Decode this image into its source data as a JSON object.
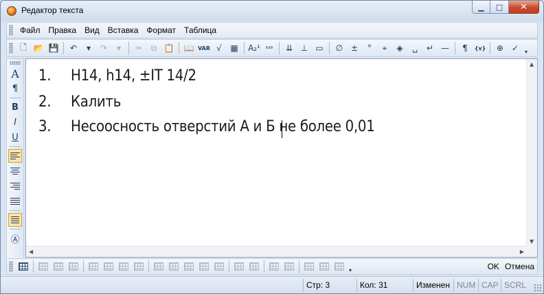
{
  "window": {
    "title": "Редактор текста",
    "controls": {
      "minimize": "▁",
      "maximize": "□",
      "close": "✕"
    }
  },
  "menu": [
    "Файл",
    "Правка",
    "Вид",
    "Вставка",
    "Формат",
    "Таблица"
  ],
  "toolbar": {
    "icons": [
      {
        "name": "new-file-icon",
        "glyph": "🗋"
      },
      {
        "name": "open-folder-icon",
        "glyph": "📂"
      },
      {
        "name": "save-icon",
        "glyph": "💾"
      },
      {
        "sep": true
      },
      {
        "name": "undo-icon",
        "glyph": "↶"
      },
      {
        "name": "undo-dropdown-icon",
        "glyph": "▾"
      },
      {
        "name": "redo-icon",
        "glyph": "↷",
        "disabled": true
      },
      {
        "name": "redo-dropdown-icon",
        "glyph": "▾",
        "disabled": true
      },
      {
        "sep": true
      },
      {
        "name": "cut-icon",
        "glyph": "✂",
        "disabled": true
      },
      {
        "name": "copy-icon",
        "glyph": "⧉",
        "disabled": true
      },
      {
        "name": "paste-icon",
        "glyph": "📋"
      },
      {
        "sep": true
      },
      {
        "name": "book-icon",
        "glyph": "📖"
      },
      {
        "name": "variable-icon",
        "glyph": "VAR",
        "small": true
      },
      {
        "name": "roughness-icon",
        "glyph": "√"
      },
      {
        "name": "image-icon",
        "glyph": "▦"
      },
      {
        "sep": true
      },
      {
        "name": "index-icon",
        "glyph": "A₂¹"
      },
      {
        "name": "fraction-icon",
        "glyph": "¹²³",
        "small": true
      },
      {
        "sep": true
      },
      {
        "name": "tolerance-icon",
        "glyph": "⇊"
      },
      {
        "name": "base-icon",
        "glyph": "⊥"
      },
      {
        "name": "form-tolerance-icon",
        "glyph": "▭"
      },
      {
        "sep": true
      },
      {
        "name": "diameter-icon",
        "glyph": "∅"
      },
      {
        "name": "plus-minus-icon",
        "glyph": "±"
      },
      {
        "name": "degree-icon",
        "glyph": "°"
      },
      {
        "name": "crosshair-icon",
        "glyph": "⌖"
      },
      {
        "name": "cube-icon",
        "glyph": "◈"
      },
      {
        "name": "space-icon",
        "glyph": "␣"
      },
      {
        "name": "line-break-icon",
        "glyph": "↵"
      },
      {
        "name": "dash-icon",
        "glyph": "—"
      },
      {
        "sep": true
      },
      {
        "name": "pilcrow-icon",
        "glyph": "¶"
      },
      {
        "name": "special-char-icon",
        "glyph": "{v}",
        "small": true
      },
      {
        "sep": true
      },
      {
        "name": "zoom-icon",
        "glyph": "⊕"
      },
      {
        "name": "check-icon",
        "glyph": "✓"
      }
    ]
  },
  "vertical_toolbar": {
    "icons": [
      {
        "name": "font-icon",
        "glyph": "A"
      },
      {
        "name": "paragraph-icon",
        "glyph": "¶"
      },
      {
        "sep": true
      },
      {
        "name": "bold-icon",
        "glyph": "B"
      },
      {
        "name": "italic-icon",
        "glyph": "I"
      },
      {
        "name": "underline-icon",
        "glyph": "U"
      },
      {
        "sep": true
      },
      {
        "name": "align-left-icon",
        "lines": [
          14,
          10,
          14,
          8
        ],
        "active": true
      },
      {
        "name": "align-center-icon",
        "lines": [
          14,
          10,
          14,
          8
        ]
      },
      {
        "name": "align-right-icon",
        "lines": [
          14,
          10,
          14,
          8
        ]
      },
      {
        "name": "align-justify-icon",
        "lines": [
          14,
          14,
          14,
          14
        ]
      },
      {
        "sep": true
      },
      {
        "name": "numbered-list-icon",
        "lines": [
          12,
          12,
          12,
          12
        ],
        "active": true
      },
      {
        "sep": true
      },
      {
        "name": "text-frame-icon",
        "glyph": "Ⓐ"
      }
    ]
  },
  "document": {
    "lines": [
      {
        "number": "1.",
        "text": "H14, h14, ±IT 14/2"
      },
      {
        "number": "2.",
        "text": "Калить"
      },
      {
        "number": "3.",
        "text": "Несоосность отверстий А и Б не более 0,01"
      }
    ]
  },
  "table_toolbar": {
    "icon_count": 20,
    "ok_label": "OK",
    "cancel_label": "Отмена"
  },
  "status_bar": {
    "line": "Стр: 3",
    "column": "Кол: 31",
    "modified": "Изменен",
    "num": "NUM",
    "cap": "CAP",
    "scrl": "SCRL"
  }
}
